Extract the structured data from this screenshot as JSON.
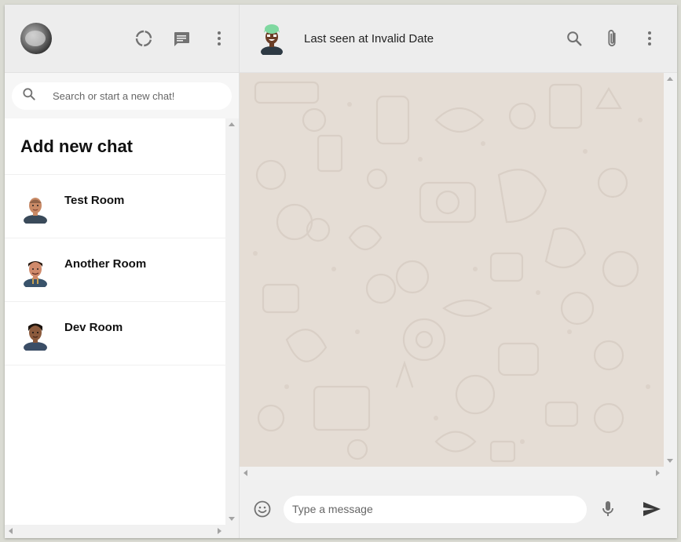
{
  "sidebar": {
    "search": {
      "placeholder": "Search or start a new chat!"
    },
    "add_new_chat": "Add new chat",
    "rooms": [
      {
        "name": "Test Room",
        "skin": "#c98a66",
        "hair": "#2a1a10",
        "shirt": "#3a4a5a"
      },
      {
        "name": "Another Room",
        "skin": "#d08a6b",
        "hair": "#2a1a10",
        "shirt": "#39536b"
      },
      {
        "name": "Dev Room",
        "skin": "#8b5a3c",
        "hair": "#1a120c",
        "shirt": "#3b4e66"
      }
    ]
  },
  "chat": {
    "last_seen": "Last seen at Invalid Date",
    "message_placeholder": "Type a message"
  },
  "colors": {
    "header_bg": "#ededed",
    "chat_bg": "#e5ddd5",
    "icon": "#727272",
    "footer_bg": "#f0f0f0"
  },
  "icons": {
    "status": "status-ring-icon",
    "new_chat": "chat-bubble-icon",
    "menu": "more-vert-icon",
    "search": "search-icon",
    "attach": "paperclip-icon",
    "emoji": "emoji-icon",
    "mic": "mic-icon",
    "send": "send-icon"
  }
}
